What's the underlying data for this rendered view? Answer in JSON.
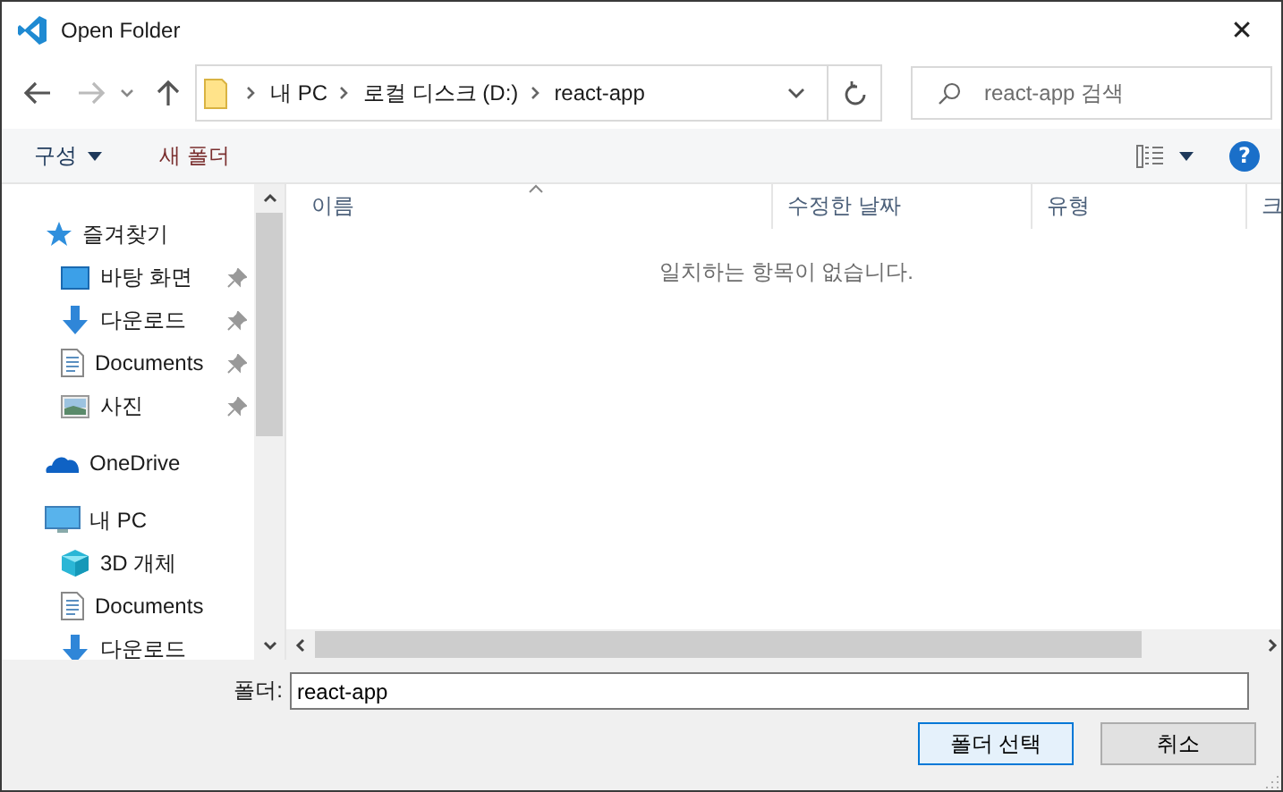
{
  "window": {
    "title": "Open Folder",
    "close": "✕"
  },
  "address": {
    "segments": [
      "내 PC",
      "로컬 디스크 (D:)",
      "react-app"
    ]
  },
  "search": {
    "placeholder": "react-app 검색"
  },
  "toolbar": {
    "organize": "구성",
    "new_folder": "새 폴더",
    "help": "?"
  },
  "navigation": [
    {
      "label": "즐겨찾기",
      "children": [
        {
          "label": "바탕 화면",
          "pinned": true
        },
        {
          "label": "다운로드",
          "pinned": true
        },
        {
          "label": "Documents",
          "pinned": true
        },
        {
          "label": "사진",
          "pinned": true
        }
      ]
    },
    {
      "label": "OneDrive"
    },
    {
      "label": "내 PC",
      "children": [
        {
          "label": "3D 개체",
          "pinned": false
        },
        {
          "label": "Documents",
          "pinned": false
        },
        {
          "label": "다운로드",
          "pinned": false
        }
      ]
    }
  ],
  "columns": [
    {
      "label": "이름",
      "sorted": true
    },
    {
      "label": "수정한 날짜",
      "sorted": false
    },
    {
      "label": "유형",
      "sorted": false
    },
    {
      "label": "크",
      "sorted": false
    }
  ],
  "empty_message": "일치하는 항목이 없습니다.",
  "folder_field": {
    "label": "폴더:",
    "value": "react-app"
  },
  "buttons": [
    {
      "label": "폴더 선택",
      "default": true
    },
    {
      "label": "취소",
      "default": false
    }
  ]
}
